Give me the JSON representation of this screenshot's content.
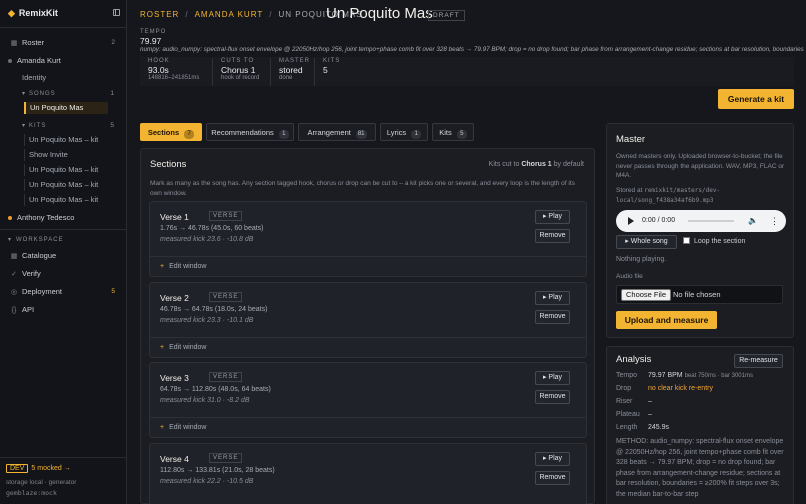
{
  "app": {
    "name": "RemixKit"
  },
  "sidebar": {
    "roster": {
      "label": "Roster",
      "count": "2"
    },
    "artist": {
      "label": "Amanda Kurt"
    },
    "identity": {
      "label": "Identity"
    },
    "songs": {
      "label": "SONGS",
      "count": "1",
      "items": [
        "Un Poquito Mas"
      ]
    },
    "kits": {
      "label": "KITS",
      "count": "5",
      "items": [
        "Un Poquito Mas – kit",
        "Show Invite",
        "Un Poquito Mas – kit",
        "Un Poquito Mas – kit",
        "Un Poquito Mas – kit"
      ]
    },
    "artist2": {
      "label": "Anthony Tedesco"
    },
    "workspace": {
      "label": "WORKSPACE"
    },
    "nav": [
      {
        "label": "Catalogue",
        "icon": "grid-icon"
      },
      {
        "label": "Verify",
        "icon": "check-icon"
      },
      {
        "label": "Deployment",
        "icon": "circle-icon",
        "count": "5"
      },
      {
        "label": "API",
        "icon": "braces-icon"
      }
    ],
    "dev": {
      "badge": "DEV",
      "mocked": "5 mocked →"
    },
    "storage": "storage local · generator",
    "generator": "gemblaze:mock"
  },
  "breadcrumb": {
    "roster": "ROSTER",
    "sep": "/",
    "artist": "AMANDA KURT",
    "song": "UN POQUITO MAS"
  },
  "page": {
    "title": "Un Poquito Mas",
    "status": "DRAFT"
  },
  "tempo": {
    "label": "TEMPO",
    "value": "79.97"
  },
  "method_line": "numpy: audio_numpy: spectral-flux onset envelope @ 22050Hz/hop 256, joint tempo+phase comb fit over 328 beats → 79.97 BPM; drop = no drop found; bar phase from arrangement-change residue; sections at bar resolution, boundaries =",
  "stats": [
    {
      "label": "HOOK",
      "value": "93.0s",
      "sub": "148816–241851ms"
    },
    {
      "label": "CUTS TO",
      "value": "Chorus 1",
      "sub": "hook of record"
    },
    {
      "label": "MASTER",
      "value": "stored",
      "sub": "done"
    },
    {
      "label": "KITS",
      "value": "5",
      "sub": ""
    }
  ],
  "generate_label": "Generate a kit",
  "tabs": [
    {
      "label": "Sections",
      "count": "7"
    },
    {
      "label": "Recommendations",
      "count": "1"
    },
    {
      "label": "Arrangement",
      "count": "81"
    },
    {
      "label": "Lyrics",
      "count": "1"
    },
    {
      "label": "Kits",
      "count": "5"
    }
  ],
  "sections_panel": {
    "title": "Sections",
    "cut_prefix": "Kits cut to",
    "cut_target": "Chorus 1",
    "cut_suffix": "by default",
    "description": "Mark as many as the song has. Any section tagged hook, chorus or drop can be cut to – a kit picks one or several, and every loop is the length of its own window.",
    "play_label": "▸ Play",
    "remove_label": "Remove",
    "edit_label": "Edit window",
    "items": [
      {
        "name": "Verse 1",
        "tag": "VERSE",
        "range": "1.76s → 46.78s (45.0s, 60 beats)",
        "measured": "measured kick 23.6 · -10.8 dB"
      },
      {
        "name": "Verse 2",
        "tag": "VERSE",
        "range": "46.78s → 64.78s (18.0s, 24 beats)",
        "measured": "measured kick 23.3 · -10.1 dB"
      },
      {
        "name": "Verse 3",
        "tag": "VERSE",
        "range": "64.78s → 112.80s (48.0s, 64 beats)",
        "measured": "measured kick 31.0 · -8.2 dB"
      },
      {
        "name": "Verse 4",
        "tag": "VERSE",
        "range": "112.80s → 133.81s (21.0s, 28 beats)",
        "measured": "measured kick 22.2 · -10.5 dB"
      }
    ]
  },
  "master": {
    "title": "Master",
    "description": "Owned masters only. Uploaded browser-to-bucket; the file never passes through the application. WAV, MP3, FLAC or M4A.",
    "stored_prefix": "Stored at",
    "stored_path": "remixkit/masters/dev-local/song_f438a34af6b9.mp3",
    "time": "0:00 / 0:00",
    "whole_song": "▸ Whole song",
    "loop_label": "Loop the section",
    "nothing": "Nothing playing.",
    "audio_file_label": "Audio file",
    "choose_file": "Choose File",
    "no_file": "No file chosen",
    "upload_label": "Upload and measure"
  },
  "analysis": {
    "title": "Analysis",
    "remeasure": "Re-measure",
    "rows": [
      {
        "k": "Tempo",
        "v": "79.97 BPM",
        "extra": "beat 750ms · bar 3001ms",
        "tone": "normal"
      },
      {
        "k": "Drop",
        "v": "no clear kick re-entry",
        "extra": "",
        "tone": "warn"
      },
      {
        "k": "Riser",
        "v": "–",
        "extra": "",
        "tone": "normal"
      },
      {
        "k": "Plateau",
        "v": "–",
        "extra": "",
        "tone": "normal"
      },
      {
        "k": "Length",
        "v": "245.9s",
        "extra": "",
        "tone": "normal"
      }
    ],
    "method": "METHOD: audio_numpy: spectral-flux onset envelope @ 22050Hz/hop 256, joint tempo+phase comb fit over 328 beats → 79.97 BPM; drop = no drop found; bar phase from arrangement-change residue; sections at bar resolution, boundaries = ≥200% fit steps over 3s; the median bar-to-bar step"
  },
  "colors": {
    "accent": "#f3b431",
    "bg": "#15171c",
    "panel": "#1b1d23"
  }
}
